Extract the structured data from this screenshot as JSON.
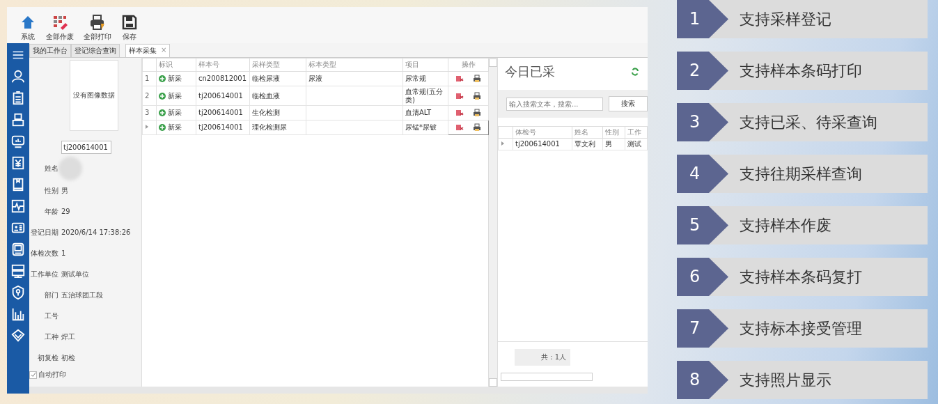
{
  "toolbar": [
    {
      "label": "系统"
    },
    {
      "label": "全部作废"
    },
    {
      "label": "全部打印"
    },
    {
      "label": "保存"
    }
  ],
  "tabs": [
    {
      "label": "我的工作台",
      "selected": false
    },
    {
      "label": "登记综合查询",
      "selected": false
    },
    {
      "label": "样本采集",
      "selected": true,
      "close": "×"
    }
  ],
  "patient": {
    "photo_text": "没有图像数据",
    "id_value": "tj200614001",
    "fields": [
      {
        "label": "姓名",
        "kind": "redacted"
      },
      {
        "label": "性别",
        "value": "男",
        "kind": "text"
      },
      {
        "label": "年龄",
        "value": "29",
        "kind": "text"
      },
      {
        "label": "登记日期",
        "value": "2020/6/14 17:38:26",
        "kind": "text"
      },
      {
        "label": "体检次数",
        "value": "1",
        "kind": "text"
      },
      {
        "label": "工作单位",
        "value": "测试单位",
        "kind": "text"
      },
      {
        "label": "部门",
        "value": "五治球团工段",
        "kind": "text"
      },
      {
        "label": "工号",
        "kind": "text"
      },
      {
        "label": "工种",
        "value": "焊工",
        "kind": "text"
      },
      {
        "label": "初复检",
        "value": "初检",
        "kind": "text"
      }
    ],
    "auto_print": {
      "label": "自动打印",
      "checked": true
    }
  },
  "samples": {
    "columns": [
      "标识",
      "样本号",
      "采样类型",
      "标本类型",
      "项目",
      "操作"
    ],
    "rows": [
      {
        "row_header": "1",
        "status": "新采",
        "sample_no": "cn200812001",
        "sample_type": "临检尿液",
        "specimen_type": "尿液",
        "item": "尿常规",
        "current": false
      },
      {
        "row_header": "2",
        "status": "新采",
        "sample_no": "tj200614001",
        "sample_type": "临检血液",
        "item": "血常规(五分类)",
        "current": false
      },
      {
        "row_header": "3",
        "status": "新采",
        "sample_no": "tj200614001",
        "sample_type": "生化检测",
        "item": "血清ALT",
        "current": false
      },
      {
        "status": "新采",
        "sample_no": "tj200614001",
        "sample_type": "理化检测尿",
        "item": "尿锰*尿铍",
        "current": true
      }
    ]
  },
  "today": {
    "title": "今日已采",
    "search": {
      "placeholder": "输入搜索文本，搜索..."
    },
    "search_button": "搜索",
    "columns": [
      "体检号",
      "姓名",
      "性别",
      "工作"
    ],
    "rows": [
      {
        "exam_no": "tj200614001",
        "name": "覃文利",
        "sex": "男",
        "unit": "测试",
        "current": true
      }
    ],
    "footer": "共：1人"
  },
  "features": [
    {
      "number": "1",
      "text": "支持采样登记"
    },
    {
      "number": "2",
      "text": "支持样本条码打印"
    },
    {
      "number": "3",
      "text": "支持已采、待采查询"
    },
    {
      "number": "4",
      "text": "支持往期采样查询"
    },
    {
      "number": "5",
      "text": "支持样本作废"
    },
    {
      "number": "6",
      "text": "支持样本条码复打"
    },
    {
      "number": "7",
      "text": "支持标本接受管理"
    },
    {
      "number": "8",
      "text": "支持照片显示"
    }
  ]
}
